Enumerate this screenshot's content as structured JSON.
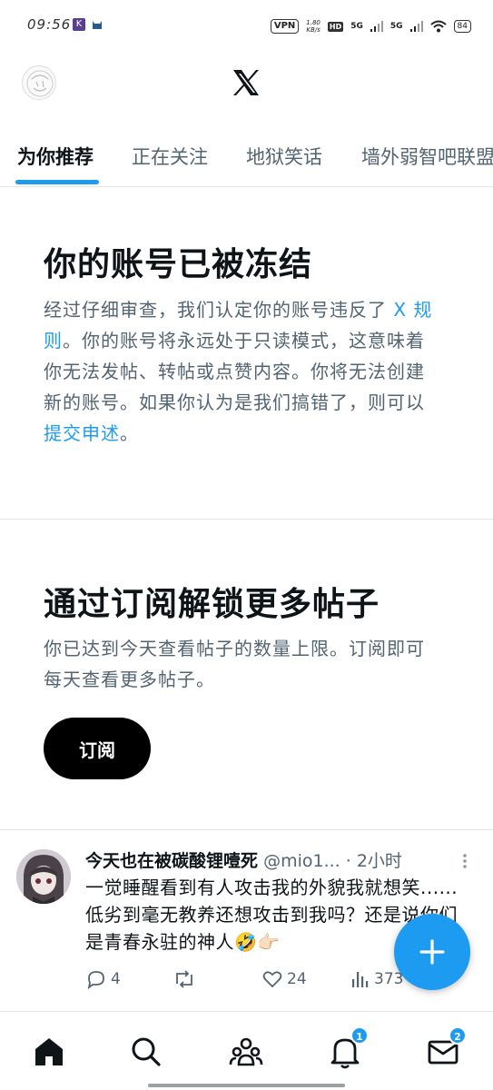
{
  "status_bar": {
    "time": "09:56",
    "app1": "K",
    "vpn": "VPN",
    "speed_value": "1.80",
    "speed_unit": "KB/s",
    "hd": "HD",
    "signal1": "5G",
    "signal2": "5G",
    "battery": "84"
  },
  "tabs": [
    {
      "label": "为你推荐",
      "active": true
    },
    {
      "label": "正在关注",
      "active": false
    },
    {
      "label": "地狱笑话",
      "active": false
    },
    {
      "label": "墙外弱智吧联盟",
      "active": false
    }
  ],
  "notice": {
    "title": "你的账号已被冻结",
    "body_part1": "经过仔细审查，我们认定你的账号违反了 ",
    "link1": "X 规则",
    "body_part2": "。你的账号将永远处于只读模式，这意味着你无法发帖、转帖或点赞内容。你将无法创建新的账号。如果你认为是我们搞错了，则可以",
    "link2": "提交申述",
    "body_part3": "。"
  },
  "subscribe": {
    "title": "通过订阅解锁更多帖子",
    "body": "你已达到今天查看帖子的数量上限。订阅即可每天查看更多帖子。",
    "button": "订阅"
  },
  "post": {
    "author": "今天也在被碳酸锂噎死",
    "handle": "@mio1...",
    "time": "· 2小时",
    "text": "一觉睡醒看到有人攻击我的外貌我就想笑......低劣到毫无教养还想攻击到我吗？还是说你们是青春永驻的神人🤣👉🏻",
    "replies": "4",
    "likes": "24",
    "views": "373"
  },
  "bottom_nav": {
    "items": [
      {
        "icon": "home-icon",
        "active": true
      },
      {
        "icon": "search-icon"
      },
      {
        "icon": "communities-icon"
      },
      {
        "icon": "notifications-icon",
        "badge": "1"
      },
      {
        "icon": "messages-icon",
        "badge": "2"
      }
    ]
  },
  "colors": {
    "accent": "#1d9bf0",
    "text_primary": "#0f1419",
    "text_secondary": "#536471"
  }
}
